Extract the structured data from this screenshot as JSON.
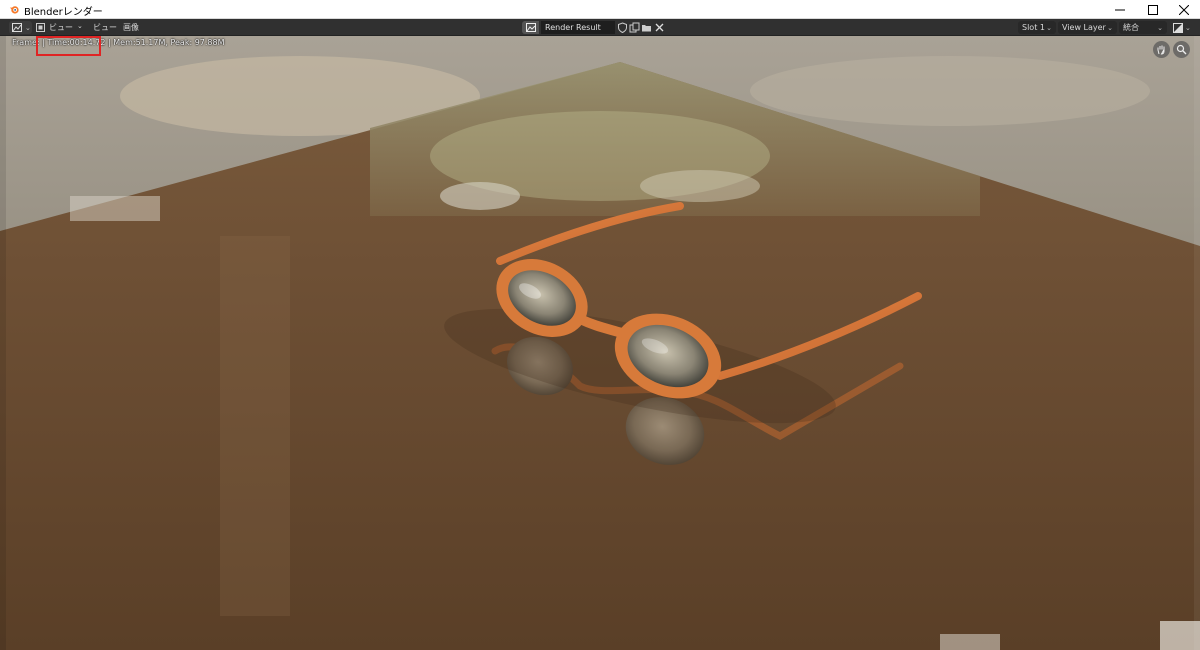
{
  "window": {
    "title": "Blenderレンダー",
    "controls": [
      "minimize-icon",
      "maximize-icon",
      "close-icon"
    ]
  },
  "header": {
    "menus": [
      "ビュー",
      "ビュー",
      "画像"
    ],
    "image_name": "Render Result",
    "slot": "Slot 1",
    "view_layer": "View Layer",
    "pass": "統合",
    "icons": [
      "editor-type-icon",
      "image-browse-icon",
      "shield-icon",
      "duplicate-icon",
      "folder-icon",
      "x-icon",
      "display-channels-icon"
    ]
  },
  "render_info": {
    "frame": "Frame:",
    "time": "| Time:00:14.72",
    "memory": "| Mem:51.17M, Peak: 97.88M"
  },
  "colors": {
    "accent_highlight": "#e02424",
    "glasses_frame": "#d97a3a",
    "header_bg": "#303030"
  }
}
